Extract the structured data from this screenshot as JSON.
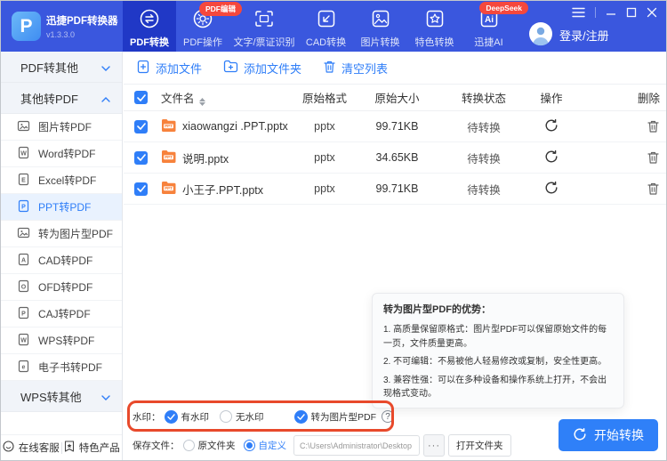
{
  "brand": {
    "name": "迅捷PDF转换器",
    "version": "v1.3.3.0",
    "logo_letter": "P"
  },
  "nav": {
    "items": [
      {
        "label": "PDF转换",
        "active": true
      },
      {
        "label": "PDF操作",
        "badge": "PDF编辑"
      },
      {
        "label": "文字/票证识别"
      },
      {
        "label": "CAD转换"
      },
      {
        "label": "图片转换"
      },
      {
        "label": "特色转换"
      },
      {
        "label": "迅捷AI",
        "badge": "DeepSeek"
      }
    ],
    "login_label": "登录/注册"
  },
  "sidebar": {
    "groups": [
      {
        "label": "PDF转其他",
        "state": "collapsed"
      },
      {
        "label": "其他转PDF",
        "state": "expanded"
      },
      {
        "label": "WPS转其他",
        "state": "collapsed"
      }
    ],
    "items": [
      {
        "label": "图片转PDF"
      },
      {
        "label": "Word转PDF"
      },
      {
        "label": "Excel转PDF"
      },
      {
        "label": "PPT转PDF",
        "selected": true
      },
      {
        "label": "转为图片型PDF"
      },
      {
        "label": "CAD转PDF"
      },
      {
        "label": "OFD转PDF"
      },
      {
        "label": "CAJ转PDF"
      },
      {
        "label": "WPS转PDF"
      },
      {
        "label": "电子书转PDF"
      }
    ],
    "footer": [
      {
        "label": "在线客服"
      },
      {
        "label": "特色产品"
      }
    ]
  },
  "toolbar": {
    "add_file": "添加文件",
    "add_folder": "添加文件夹",
    "clear_list": "清空列表"
  },
  "table": {
    "headers": {
      "name": "文件名",
      "format": "原始格式",
      "size": "原始大小",
      "status": "转换状态",
      "action": "操作",
      "delete": "删除"
    },
    "rows": [
      {
        "name": "xiaowangzi .PPT.pptx",
        "format": "pptx",
        "size": "99.71KB",
        "status": "待转换"
      },
      {
        "name": "说明.pptx",
        "format": "pptx",
        "size": "34.65KB",
        "status": "待转换"
      },
      {
        "name": "小王子.PPT.pptx",
        "format": "pptx",
        "size": "99.71KB",
        "status": "待转换"
      }
    ]
  },
  "tooltip": {
    "title": "转为图片型PDF的优势：",
    "points": [
      "1. 高质量保留原格式：图片型PDF可以保留原始文件的每一页，文件质量更高。",
      "2. 不可编辑：不易被他人轻易修改或复制，安全性更高。",
      "3. 兼容性强：可以在多种设备和操作系统上打开，不会出现格式变动。"
    ]
  },
  "watermark": {
    "label": "水印：",
    "with_wm": "有水印",
    "without_wm": "无水印",
    "to_image_pdf": "转为图片型PDF"
  },
  "save": {
    "label": "保存文件：",
    "original": "原文件夹",
    "custom": "自定义",
    "path": "C:\\Users\\Administrator\\Desktop",
    "more": "···",
    "open": "打开文件夹"
  },
  "convert": {
    "label": "开始转换"
  },
  "colors": {
    "header_blue": "#3a57de",
    "active_tab_blue": "#2038c6",
    "accent_blue": "#2f7ef8",
    "badge_red": "#f5483d",
    "annotation_orange": "#e8492b",
    "file_icon_orange": "#f7823c"
  }
}
